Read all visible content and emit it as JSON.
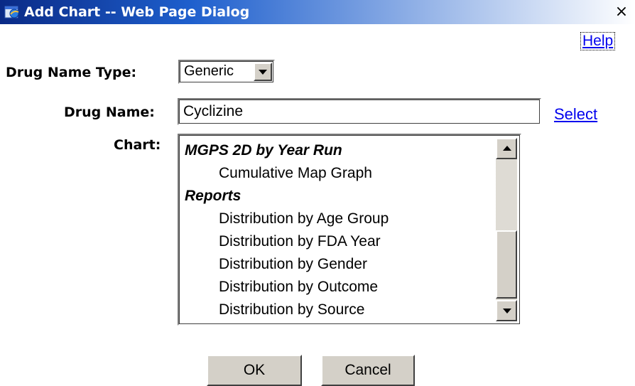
{
  "window": {
    "title": "Add Chart -- Web Page Dialog",
    "close_glyph": "×"
  },
  "help_link": "Help",
  "form": {
    "drug_name_type": {
      "label": "Drug Name Type:",
      "selected": "Generic"
    },
    "drug_name": {
      "label": "Drug Name:",
      "value": "Cyclizine",
      "select_link": "Select"
    },
    "chart": {
      "label": "Chart:",
      "items": [
        {
          "text": "MGPS 2D by Year Run",
          "kind": "group"
        },
        {
          "text": "Cumulative Map Graph",
          "kind": "child"
        },
        {
          "text": "Reports",
          "kind": "group"
        },
        {
          "text": "Distribution by Age Group",
          "kind": "child"
        },
        {
          "text": "Distribution by FDA Year",
          "kind": "child"
        },
        {
          "text": "Distribution by Gender",
          "kind": "child"
        },
        {
          "text": "Distribution by Outcome",
          "kind": "child"
        },
        {
          "text": "Distribution by Source",
          "kind": "child"
        }
      ]
    }
  },
  "buttons": {
    "ok": "OK",
    "cancel": "Cancel"
  },
  "colors": {
    "titlebar_start": "#0a2a86",
    "titlebar_end": "#ffffff",
    "button_face": "#d4d0c8",
    "link": "#0000ee"
  },
  "icons": {
    "app": "ie-dialog-icon",
    "close": "close-icon",
    "dropdown": "chevron-down-icon",
    "scroll_up": "scroll-up-arrow-icon",
    "scroll_down": "scroll-down-arrow-icon"
  }
}
